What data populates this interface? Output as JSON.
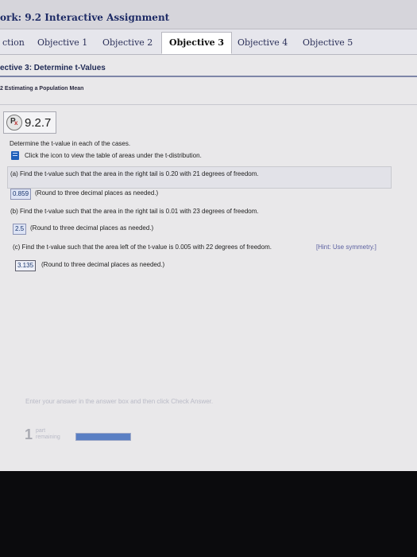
{
  "header": {
    "title": "ork: 9.2 Interactive Assignment"
  },
  "tabs": [
    {
      "label": "ction"
    },
    {
      "label": "Objective 1"
    },
    {
      "label": "Objective 2"
    },
    {
      "label": "Objective 3"
    },
    {
      "label": "Objective 4"
    },
    {
      "label": "Objective 5"
    }
  ],
  "active_tab": "Objective 3",
  "section": {
    "heading": "ective 3: Determine t-Values",
    "subheading": "2 Estimating a Population Mean"
  },
  "problem": {
    "number": "9.2.7",
    "instruction": "Determine the t-value in each of the cases.",
    "table_link": "Click the icon to view the table of areas under the t-distribution.",
    "parts": [
      {
        "question": "(a) Find the t-value such that the area in the right tail is 0.20 with 21 degrees of freedom.",
        "answer": "0.859",
        "note": "(Round to three decimal places as needed.)"
      },
      {
        "question": "(b) Find the t-value such that the area in the right tail is 0.01 with 23 degrees of freedom.",
        "answer": "2.5",
        "note": "(Round to three decimal places as needed.)"
      },
      {
        "question": "(c) Find the t-value such that the area left of the t-value is 0.005 with 22 degrees of freedom.",
        "hint": "[Hint: Use symmetry.]",
        "answer": "3.135",
        "note": "(Round to three decimal places as needed.)"
      }
    ]
  },
  "footer": {
    "instruction": "Enter your answer in the answer box and then click Check Answer.",
    "parts_remaining_count": "1",
    "parts_remaining_label_1": "part",
    "parts_remaining_label_2": "remaining",
    "progress_fraction": 1.0
  },
  "colors": {
    "accent": "#1f2a55",
    "progress": "#5a7fc4",
    "answer_bg": "#dde3f4"
  }
}
